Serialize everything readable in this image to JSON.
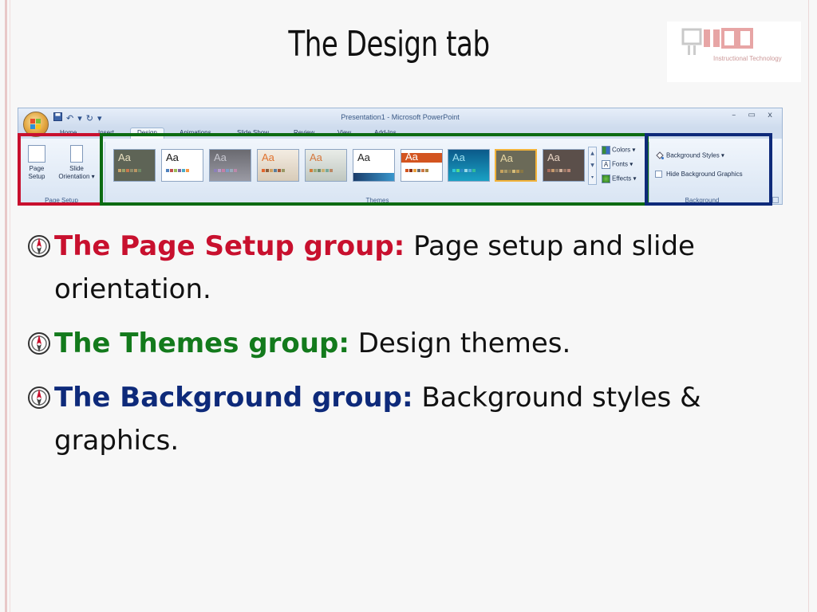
{
  "slide": {
    "title": "The Design tab",
    "logo_caption": "Instructional Technology"
  },
  "window": {
    "title": "Presentation1 - Microsoft PowerPoint",
    "controls": "– ▭ x"
  },
  "tabs": [
    {
      "label": "Home",
      "active": false
    },
    {
      "label": "Insert",
      "active": false
    },
    {
      "label": "Design",
      "active": true
    },
    {
      "label": "Animations",
      "active": false
    },
    {
      "label": "Slide Show",
      "active": false
    },
    {
      "label": "Review",
      "active": false
    },
    {
      "label": "View",
      "active": false
    },
    {
      "label": "Add-Ins",
      "active": false
    }
  ],
  "groups": {
    "page_setup": {
      "label": "Page Setup",
      "page_setup_line1": "Page",
      "page_setup_line2": "Setup",
      "orientation_line1": "Slide",
      "orientation_line2": "Orientation ▾"
    },
    "themes": {
      "label": "Themes",
      "thumb_text": "Aa",
      "colors": "Colors ▾",
      "fonts": "Fonts ▾",
      "effects": "Effects ▾",
      "font_glyph": "A"
    },
    "background": {
      "label": "Background",
      "styles": "Background Styles ▾",
      "hide": "Hide Background Graphics"
    }
  },
  "bullets": [
    {
      "lead": "The Page Setup group:",
      "rest": " Page setup and slide",
      "cont": "orientation.",
      "color": "#c8102e"
    },
    {
      "lead": "The Themes group:",
      "rest": " Design themes.",
      "cont": "",
      "color": "#137a1c"
    },
    {
      "lead": "The Background group:",
      "rest": " Background styles &",
      "cont": "graphics.",
      "color": "#0e2a7a"
    }
  ]
}
